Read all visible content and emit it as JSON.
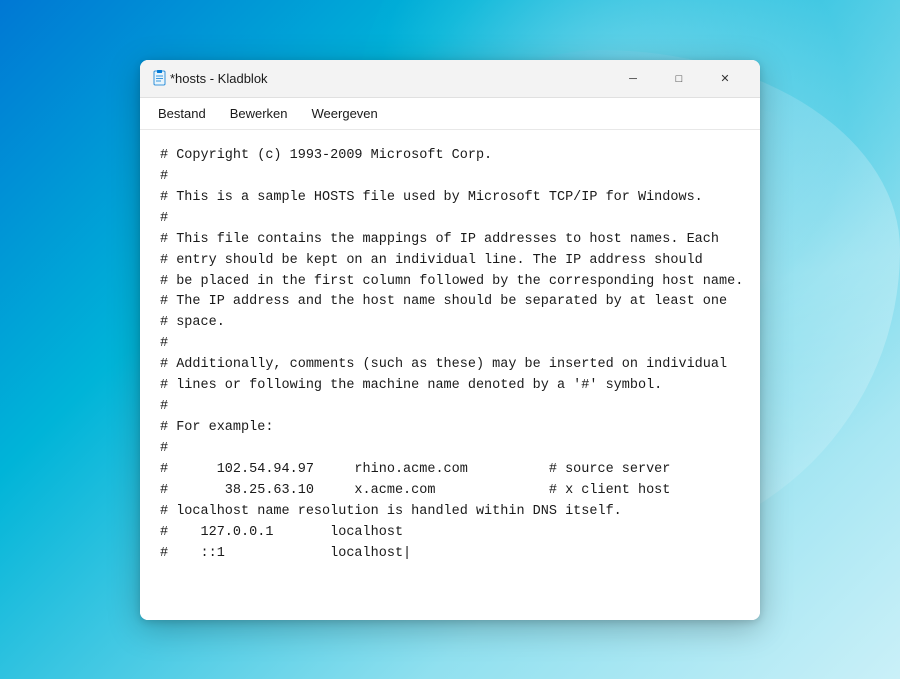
{
  "desktop": {
    "background": "windows11-gradient"
  },
  "window": {
    "title": "*hosts - Kladblok",
    "icon": "notepad-icon"
  },
  "menu": {
    "items": [
      {
        "id": "bestand",
        "label": "Bestand"
      },
      {
        "id": "bewerken",
        "label": "Bewerken"
      },
      {
        "id": "weergeven",
        "label": "Weergeven"
      }
    ]
  },
  "controls": {
    "minimize": "─",
    "maximize": "□",
    "close": "✕"
  },
  "editor": {
    "content": [
      "# Copyright (c) 1993-2009 Microsoft Corp.",
      "#",
      "# This is a sample HOSTS file used by Microsoft TCP/IP for Windows.",
      "#",
      "# This file contains the mappings of IP addresses to host names. Each",
      "# entry should be kept on an individual line. The IP address should",
      "# be placed in the first column followed by the corresponding host name.",
      "# The IP address and the host name should be separated by at least one",
      "# space.",
      "#",
      "# Additionally, comments (such as these) may be inserted on individual",
      "# lines or following the machine name denoted by a '#' symbol.",
      "#",
      "# For example:",
      "#",
      "#      102.54.94.97     rhino.acme.com          # source server",
      "#       38.25.63.10     x.acme.com              # x client host",
      "",
      "# localhost name resolution is handled within DNS itself.",
      "#\t127.0.0.1       localhost",
      "#\t::1             localhost"
    ]
  }
}
